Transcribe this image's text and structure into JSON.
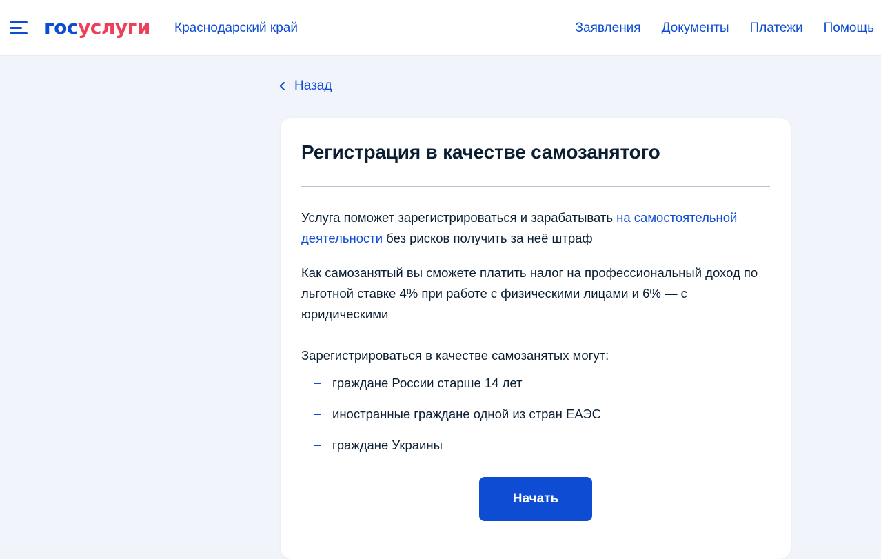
{
  "header": {
    "logo_part1": "гос",
    "logo_part2": "услуги",
    "region": "Краснодарский край",
    "nav": [
      "Заявления",
      "Документы",
      "Платежи",
      "Помощь"
    ]
  },
  "back_label": "Назад",
  "card": {
    "title": "Регистрация в качестве самозанятого",
    "p1_pre": "Услуга поможет зарегистрироваться и зарабатывать ",
    "p1_link": "на самостоятельной деятельности",
    "p1_post": " без рисков получить за неё штраф",
    "p2": "Как самозанятый вы сможете платить налог на профессиональный доход по льготной ставке 4% при работе с физическими лицами и 6% — с юридическими",
    "p3": "Зарегистрироваться в качестве самозанятых могут:",
    "list": [
      "граждане России старше 14 лет",
      "иностранные граждане одной из стран ЕАЭС",
      "граждане Украины"
    ],
    "start_button": "Начать"
  },
  "colors": {
    "brand_blue": "#0d4cd3",
    "brand_red": "#ee3f58",
    "background": "#f1f5fb",
    "text": "#0b1f33"
  },
  "icons": [
    "menu-icon",
    "chevron-left-icon",
    "dash-bullet-icon"
  ]
}
